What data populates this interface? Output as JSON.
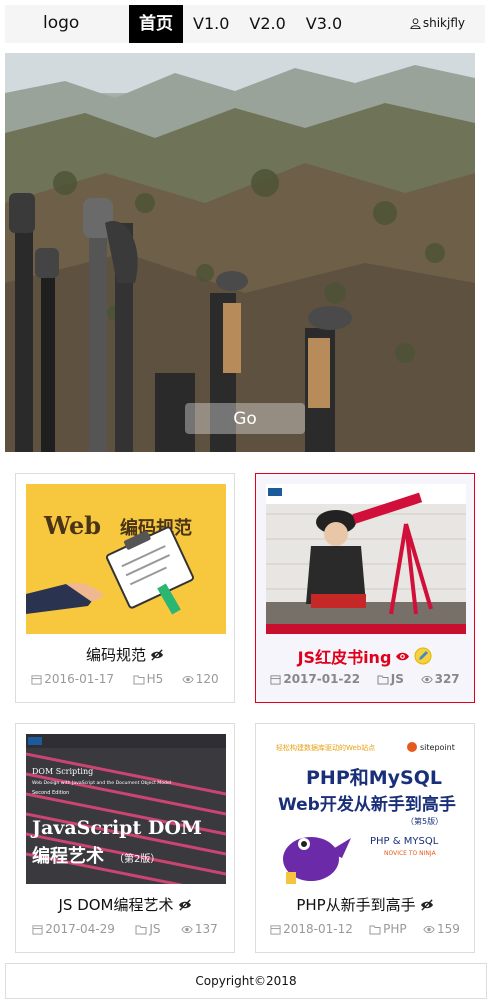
{
  "nav": {
    "logo": "logo",
    "links": [
      "首页",
      "V1.0",
      "V2.0",
      "V3.0"
    ],
    "user": "shikjfly"
  },
  "hero": {
    "button": "Go"
  },
  "cards": [
    {
      "title": "编码规范",
      "date": "2016-01-17",
      "category": "H5",
      "views": "120",
      "cover_text": [
        "Web",
        "编码规范"
      ]
    },
    {
      "title": "JS红皮书ing",
      "date": "2017-01-22",
      "category": "JS",
      "views": "327"
    },
    {
      "title": "JS DOM编程艺术",
      "date": "2017-04-29",
      "category": "JS",
      "views": "137",
      "cover_text": [
        "DOM Scripting",
        "Web Design with JavaScript and the Document Object Model",
        "Second Edition",
        "JavaScript DOM",
        "编程艺术",
        "（第2版）"
      ]
    },
    {
      "title": "PHP从新手到高手",
      "date": "2018-01-12",
      "category": "PHP",
      "views": "159",
      "cover_text": [
        "轻松构建数据库驱动的Web站点",
        "sitepoint",
        "PHP和MySQL",
        "Web开发从新手到高手",
        "（第5版）",
        "PHP & MYSQL",
        "NOVICE TO NINJA"
      ]
    }
  ],
  "footer": "Copyright©2018",
  "colors": {
    "accent": "#e0001a",
    "nav_active": "#000000",
    "muted": "#999999"
  }
}
